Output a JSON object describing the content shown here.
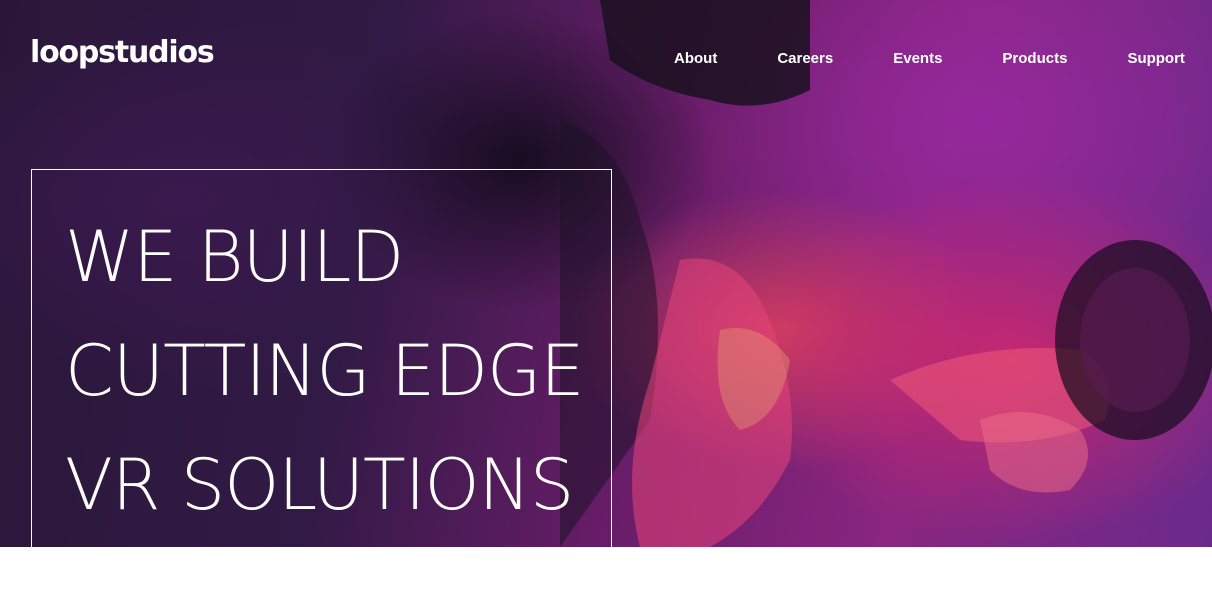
{
  "brand": {
    "logo_text": "loopstudios"
  },
  "nav": {
    "items": [
      {
        "label": "About"
      },
      {
        "label": "Careers"
      },
      {
        "label": "Events"
      },
      {
        "label": "Products"
      },
      {
        "label": "Support"
      }
    ]
  },
  "hero": {
    "headline_lines": [
      "WE BUILD",
      "CUTTING EDGE",
      "VR SOLUTIONS"
    ]
  },
  "colors": {
    "text": "#ffffff",
    "overlay_dark": "#2a1738",
    "overlay_magenta": "#8a2680",
    "overlay_pink": "#d2286e",
    "page_background": "#ffffff"
  }
}
